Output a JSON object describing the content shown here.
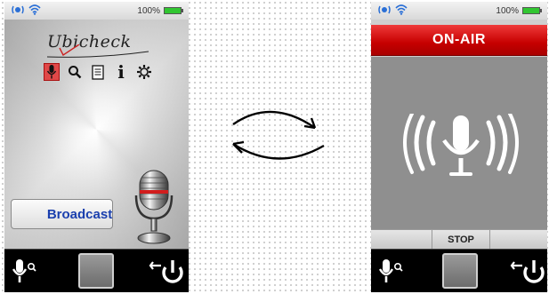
{
  "left_screen": {
    "status": {
      "battery": "100%"
    },
    "logo": "Ubicheck",
    "toolbar": {
      "items": [
        {
          "icon": "microphone-icon",
          "active": true
        },
        {
          "icon": "search-icon",
          "active": false
        },
        {
          "icon": "document-icon",
          "active": false
        },
        {
          "icon": "info-icon",
          "active": false,
          "glyph": "i"
        },
        {
          "icon": "gear-icon",
          "active": false
        }
      ]
    },
    "broadcast_label": "Broadcast",
    "bottom_bar": {
      "icons": [
        "mic-search-icon",
        "home-square-button",
        "exit-power-icon"
      ]
    }
  },
  "right_screen": {
    "status": {
      "battery": "100%"
    },
    "onair_label": "ON-AIR",
    "stop_label": "STOP",
    "bottom_bar": {
      "icons": [
        "mic-search-icon",
        "home-square-button",
        "exit-power-icon"
      ]
    }
  },
  "colors": {
    "onair_red": "#d41111",
    "broadcast_text": "#1a3fae",
    "stage_gray": "#8f8f8f",
    "battery_green": "#31c631"
  }
}
